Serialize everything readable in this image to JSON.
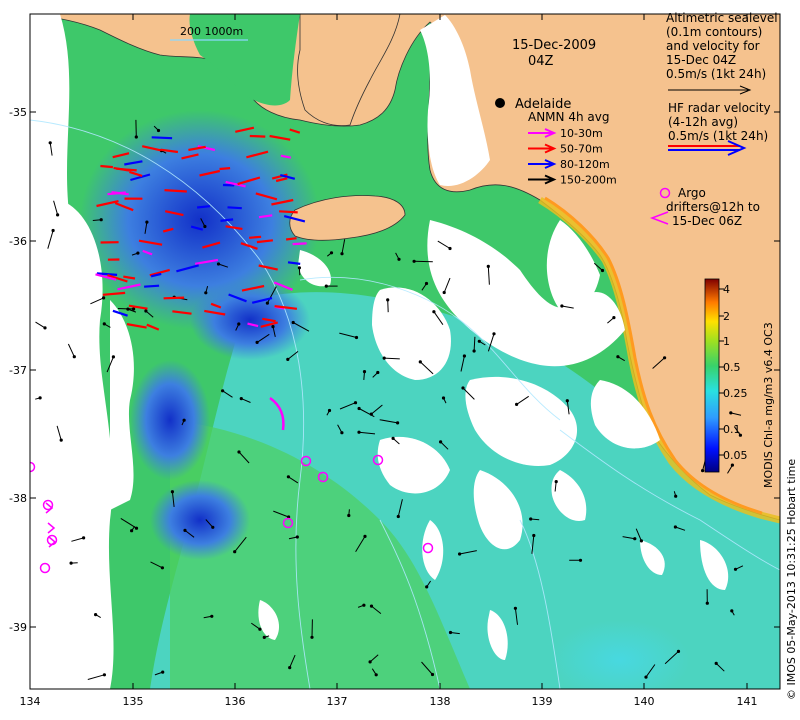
{
  "map": {
    "date_title": "15-Dec-2009",
    "time_title": "04Z",
    "scale_bar_label": "200  1000m",
    "place_label": "Adelaide",
    "x_ticks": [
      "134",
      "135",
      "136",
      "137",
      "138",
      "139",
      "140",
      "141"
    ],
    "y_ticks": [
      "-35",
      "-36",
      "-37",
      "-38",
      "-39"
    ],
    "credit": "© IMOS 05-May-2013 10:31:25 Hobart time"
  },
  "legend": {
    "altimetry_lines": [
      "Altimetric sealevel",
      "(0.1m contours)",
      "and velocity for",
      "15-Dec 04Z",
      "0.5m/s (1kt 24h)"
    ],
    "hf_radar_lines": [
      "HF radar velocity",
      "(4-12h avg)",
      "0.5m/s (1kt 24h)"
    ],
    "anmn_title": "ANMN 4h avg",
    "anmn_items": [
      {
        "label": "10-30m",
        "color": "#ff00ff"
      },
      {
        "label": "50-70m",
        "color": "#ff0000"
      },
      {
        "label": "80-120m",
        "color": "#0000ff"
      },
      {
        "label": "150-200m",
        "color": "#000000"
      }
    ],
    "argo_lines": [
      "Argo",
      "drifters@12h to",
      "15-Dec 06Z"
    ],
    "argo_color": "#ff00ff"
  },
  "colorbar": {
    "label": "MODIS Chl-a mg/m3 v6.4 OC3",
    "ticks": [
      "4",
      "2",
      "1",
      "0.5",
      "0.25",
      "0.1",
      "0.05"
    ]
  },
  "colors": {
    "land": "#f5c28e",
    "ocean_green": "#3dc85a",
    "ocean_cyan": "#4ad8d0",
    "ocean_blue": "#3c8be0",
    "cloud": "#ffffff"
  }
}
